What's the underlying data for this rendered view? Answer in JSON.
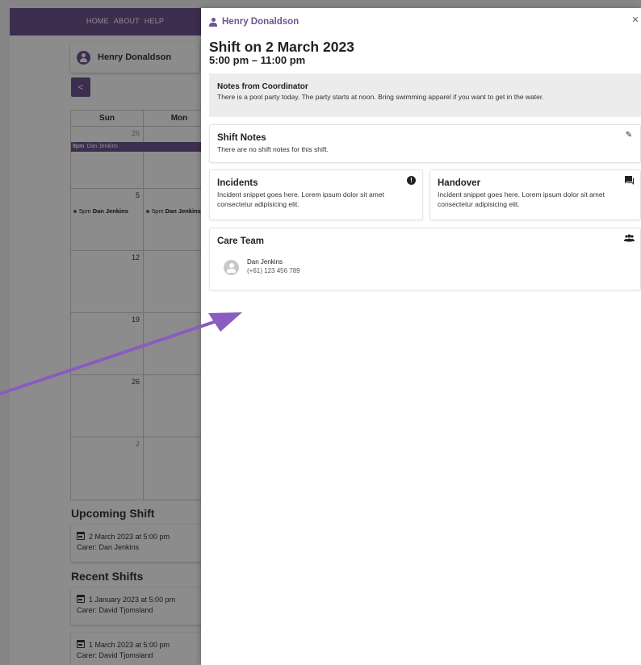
{
  "nav": {
    "items": [
      "HOME",
      "ABOUT",
      "HELP"
    ]
  },
  "client": {
    "name": "Henry Donaldson"
  },
  "calendar": {
    "prev_label": "<",
    "days": [
      "Sun",
      "Mon"
    ],
    "weeks": [
      {
        "dates": [
          "26",
          ""
        ],
        "muted": true,
        "bar": {
          "time": "9pm",
          "name": "Dan Jenkins"
        }
      },
      {
        "dates": [
          "5",
          ""
        ],
        "events": [
          {
            "time": "5pm",
            "name": "Dan Jenkins"
          },
          {
            "time": "5pm",
            "name": "Dan Jenkins"
          }
        ]
      },
      {
        "dates": [
          "12",
          ""
        ]
      },
      {
        "dates": [
          "19",
          ""
        ]
      },
      {
        "dates": [
          "26",
          ""
        ]
      },
      {
        "dates": [
          "2",
          ""
        ],
        "muted": true
      }
    ]
  },
  "upcoming": {
    "title": "Upcoming Shift",
    "shifts": [
      {
        "date": "2 March 2023 at 5:00 pm",
        "carer": "Carer: Dan Jenkins"
      }
    ]
  },
  "recent": {
    "title": "Recent Shifts",
    "shifts": [
      {
        "date": "1 January 2023 at 5:00 pm",
        "carer": "Carer: David Tjomsland"
      },
      {
        "date": "1 March 2023 at 5:00 pm",
        "carer": "Carer: David Tjomsland"
      }
    ]
  },
  "drawer": {
    "client_name": "Henry Donaldson",
    "close_label": "×",
    "title": "Shift on 2 March 2023",
    "time": "5:00 pm – 11:00 pm",
    "coordinator_notes": {
      "title": "Notes from Coordinator",
      "text": "There is a pool party today. The party starts at noon. Bring swimming apparel if you want to get in the water."
    },
    "shift_notes": {
      "title": "Shift Notes",
      "text": "There are no shift notes for this shift."
    },
    "incidents": {
      "title": "Incidents",
      "text": "Incident snippet goes here. Lorem ipsum dolor sit amet consectetur adipisicing elit."
    },
    "handover": {
      "title": "Handover",
      "text": "Incident snippet goes here. Lorem ipsum dolor sit amet consectetur adipisicing elit."
    },
    "care_team": {
      "title": "Care Team",
      "members": [
        {
          "name": "Dan Jenkins",
          "phone": "(+61) 123 456 789"
        }
      ]
    }
  },
  "colors": {
    "brand": "#6f5590",
    "overlay": "rgba(0,0,0,0.45)",
    "arrow": "#8a5cc0"
  },
  "icons": [
    "person-icon",
    "close-icon",
    "pencil-icon",
    "alert-icon",
    "chat-icon",
    "group-icon",
    "calendar-icon",
    "avatar-icon",
    "annotation-arrow"
  ]
}
